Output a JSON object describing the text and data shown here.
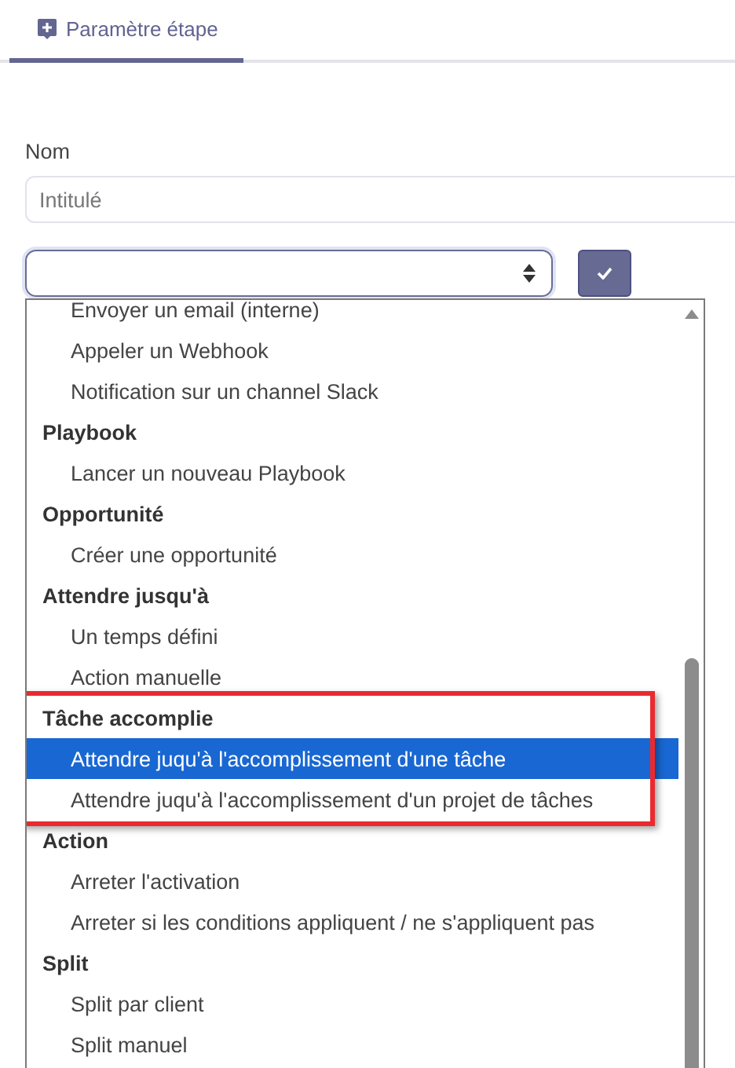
{
  "tabs": [
    {
      "label": "Paramètre étape",
      "selected": true
    }
  ],
  "name_field": {
    "label": "Nom",
    "placeholder": "Intitulé"
  },
  "dropdown": {
    "groups": [
      {
        "options": [
          {
            "label": "Envoyer un email (interne)",
            "selected": false
          },
          {
            "label": "Appeler un Webhook",
            "selected": false
          },
          {
            "label": "Notification sur un channel Slack",
            "selected": false
          }
        ]
      },
      {
        "label": "Playbook",
        "highlighted": false,
        "options": [
          {
            "label": "Lancer un nouveau Playbook",
            "selected": false
          }
        ]
      },
      {
        "label": "Opportunité",
        "highlighted": false,
        "options": [
          {
            "label": "Créer une opportunité",
            "selected": false
          }
        ]
      },
      {
        "label": "Attendre jusqu'à",
        "highlighted": false,
        "options": [
          {
            "label": "Un temps défini",
            "selected": false
          },
          {
            "label": "Action manuelle",
            "selected": false
          }
        ]
      },
      {
        "label": "Tâche accomplie",
        "highlighted": true,
        "options": [
          {
            "label": "Attendre juqu'à l'accomplissement d'une tâche",
            "selected": true
          },
          {
            "label": "Attendre juqu'à l'accomplissement d'un projet de tâches",
            "selected": false
          }
        ]
      },
      {
        "label": "Action",
        "highlighted": false,
        "options": [
          {
            "label": "Arreter l'activation",
            "selected": false
          },
          {
            "label": "Arreter si les conditions appliquent / ne s'appliquent pas",
            "selected": false
          }
        ]
      },
      {
        "label": "Split",
        "highlighted": false,
        "options": [
          {
            "label": "Split par client",
            "selected": false
          },
          {
            "label": "Split manuel",
            "selected": false
          }
        ]
      }
    ]
  }
}
